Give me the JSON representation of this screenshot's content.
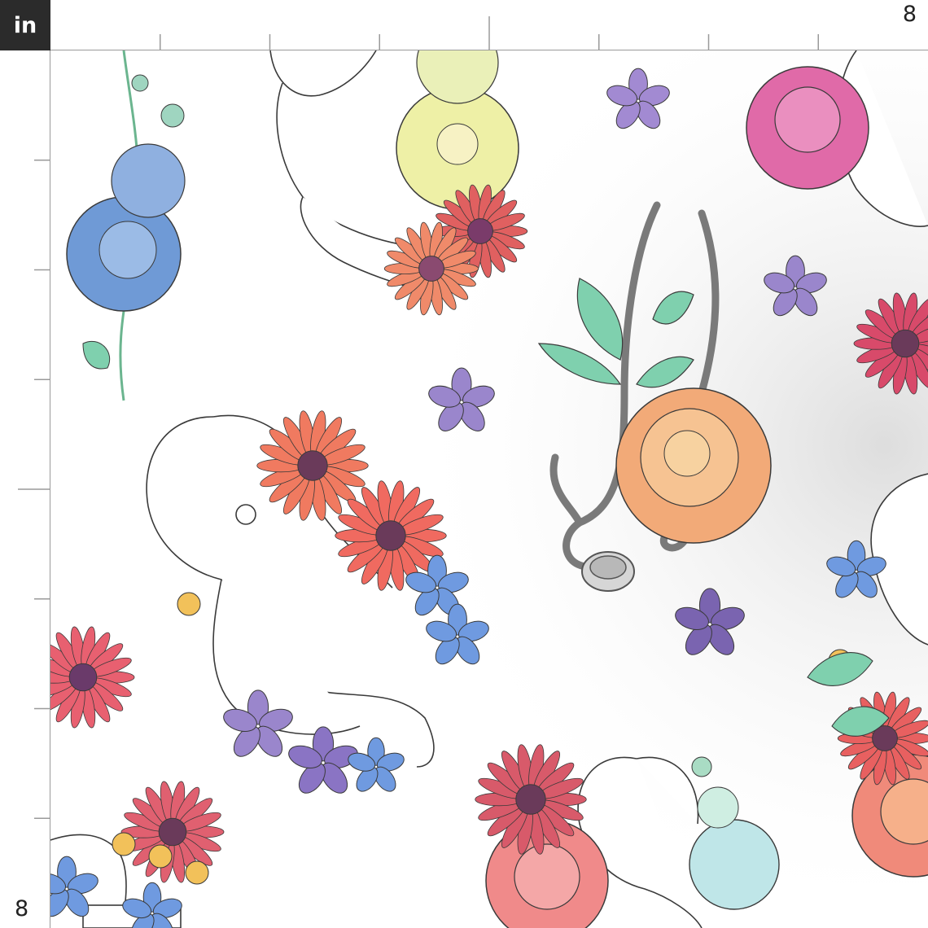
{
  "ruler": {
    "unit": "in",
    "top_end_label": "8",
    "left_end_label": "8"
  },
  "colors": {
    "ruler_corner": "#2b2b2b",
    "ruler_border": "#9a9a9a",
    "outline": "#3a3a3a",
    "blue_petal": "#6f9ad6",
    "yellow_petal": "#eef0a6",
    "red_petal": "#e06060",
    "orange_petal": "#f2aa78",
    "pink_petal": "#e06aa8",
    "purple_petal": "#9a86cc",
    "leaf": "#7fd0ae",
    "stethoscope": "#7a7a7a"
  }
}
